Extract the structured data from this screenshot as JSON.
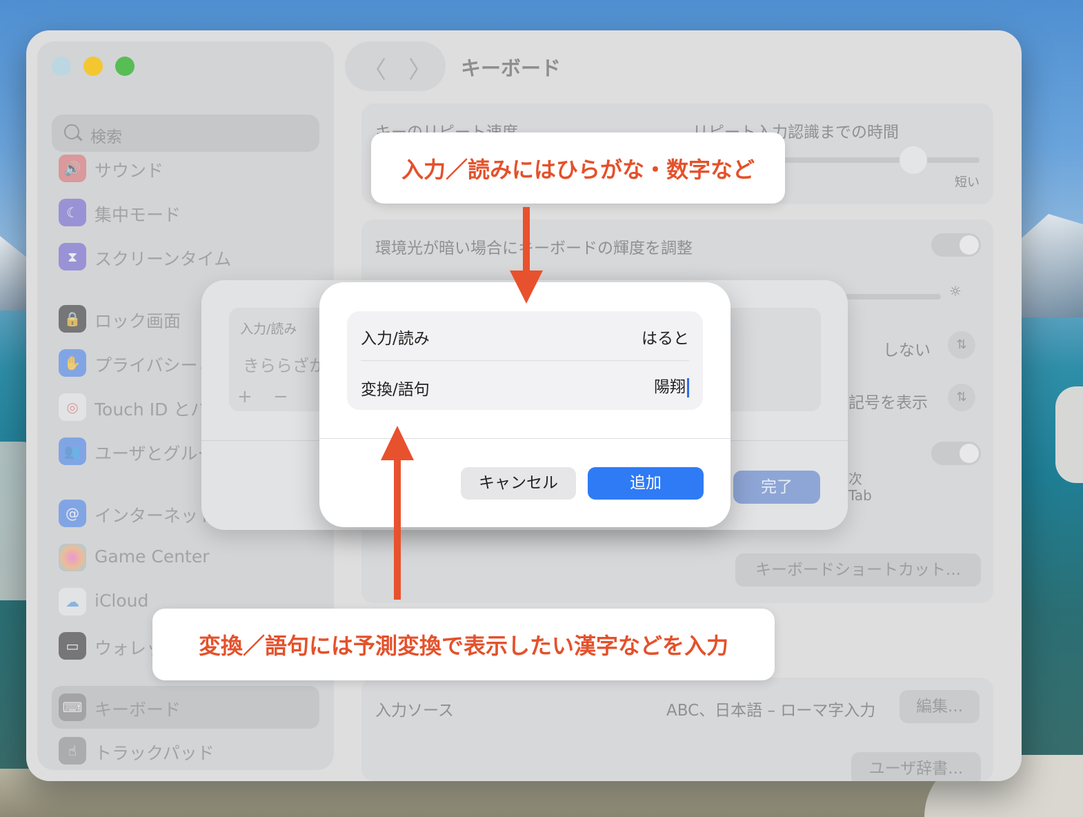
{
  "window": {
    "title": "キーボード"
  },
  "sidebar": {
    "search_placeholder": "検索",
    "items": [
      {
        "label": "サウンド",
        "icon": "speaker-icon",
        "color": "#e06a6a"
      },
      {
        "label": "集中モード",
        "icon": "moon-icon",
        "color": "#6a5ed6"
      },
      {
        "label": "スクリーンタイム",
        "icon": "hourglass-icon",
        "color": "#6a5ed6"
      },
      {
        "label": "ロック画面",
        "icon": "lock-icon",
        "color": "#2b2b2d"
      },
      {
        "label": "プライバシーと",
        "icon": "hand-icon",
        "color": "#3f7ff0"
      },
      {
        "label": "Touch ID とパ",
        "icon": "fingerprint-icon",
        "color": "#f0f0f0"
      },
      {
        "label": "ユーザとグルー",
        "icon": "users-icon",
        "color": "#3f7ff0"
      },
      {
        "label": "インターネット",
        "icon": "at-icon",
        "color": "#3f7ff0"
      },
      {
        "label": "Game Center",
        "icon": "game-center-icon",
        "color": "#e06aa0"
      },
      {
        "label": "iCloud",
        "icon": "cloud-icon",
        "color": "#f0f0f0"
      },
      {
        "label": "ウォレッ",
        "icon": "wallet-icon",
        "color": "#2b2b2d"
      },
      {
        "label": "キーボード",
        "icon": "keyboard-icon",
        "color": "#8a8a8c"
      },
      {
        "label": "トラックパッド",
        "icon": "trackpad-icon",
        "color": "#8a8a8c"
      }
    ]
  },
  "nav": {
    "back": "〈",
    "forward": "〉"
  },
  "settings": {
    "key_repeat_label": "キーのリピート速度",
    "delay_label": "リピート入力認識までの時間",
    "short_label": "短い",
    "backlight_label": "環境光が暗い場合にキーボードの輝度を調整",
    "popup_value": "しない",
    "popup_value2": "記号を表示",
    "next_label": "次",
    "tab_label": "Tab",
    "shortcuts_button": "キーボードショートカット...",
    "input_sources_label": "入力ソース",
    "input_sources_value": "ABC、日本語 – ローマ字入力",
    "edit_button": "編集...",
    "user_dict_button": "ユーザ辞書..."
  },
  "sheet": {
    "column_header": "入力/読み",
    "cell_value": "きららざか",
    "add_symbol": "+",
    "remove_symbol": "−",
    "done_button": "完了"
  },
  "dialog": {
    "reading_label": "入力/読み",
    "reading_value": "はると",
    "phrase_label": "変換/語句",
    "phrase_value": "陽翔",
    "cancel_button": "キャンセル",
    "add_button": "追加"
  },
  "annotations": {
    "top_callout": "入力／読みにはひらがな・数字など",
    "bottom_callout": "変換／語句には予測変換で表示したい漢字などを入力",
    "accent_color": "#e8512d"
  }
}
